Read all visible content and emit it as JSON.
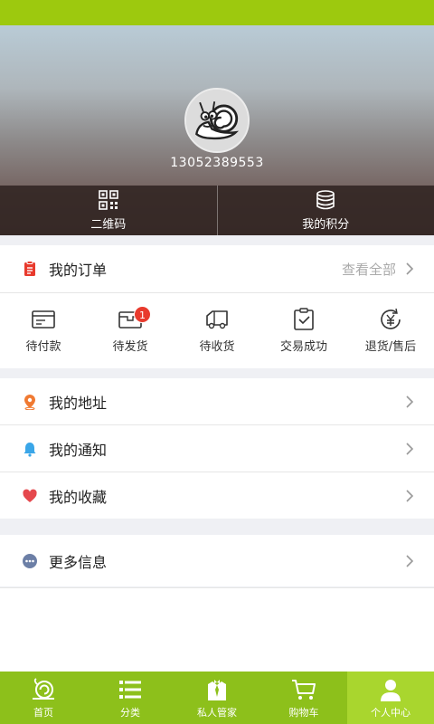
{
  "colors": {
    "accent": "#9dc90e",
    "tabbar": "#8dc01b",
    "tab_active": "#a9d62e",
    "badge": "#e83a2d",
    "order_icon": "#e83a2d",
    "address_icon": "#f07a32",
    "notice_icon": "#3aa6e8",
    "fav_icon": "#e5484d",
    "more_icon": "#6c7fa6"
  },
  "profile": {
    "avatar_icon": "snail-avatar",
    "phone": "13052389553"
  },
  "quick": [
    {
      "label": "二维码",
      "icon": "qrcode-icon"
    },
    {
      "label": "我的积分",
      "icon": "points-stack-icon"
    }
  ],
  "orders": {
    "title": "我的订单",
    "view_all": "查看全部",
    "states": [
      {
        "label": "待付款",
        "icon": "wallet-icon"
      },
      {
        "label": "待发货",
        "icon": "package-icon",
        "badge": "1"
      },
      {
        "label": "待收货",
        "icon": "truck-icon"
      },
      {
        "label": "交易成功",
        "icon": "clipboard-check-icon"
      },
      {
        "label": "退货/售后",
        "icon": "yen-refund-icon"
      }
    ]
  },
  "menu": [
    {
      "label": "我的地址",
      "icon": "location-pin-icon"
    },
    {
      "label": "我的通知",
      "icon": "bell-icon"
    },
    {
      "label": "我的收藏",
      "icon": "heart-icon"
    }
  ],
  "more": {
    "label": "更多信息",
    "icon": "more-dots-icon"
  },
  "tabs": [
    {
      "label": "首页",
      "icon": "snail-home-icon",
      "active": false
    },
    {
      "label": "分类",
      "icon": "list-icon",
      "active": false
    },
    {
      "label": "私人管家",
      "icon": "butler-icon",
      "active": false
    },
    {
      "label": "购物车",
      "icon": "cart-icon",
      "active": false
    },
    {
      "label": "个人中心",
      "icon": "user-icon",
      "active": true
    }
  ]
}
